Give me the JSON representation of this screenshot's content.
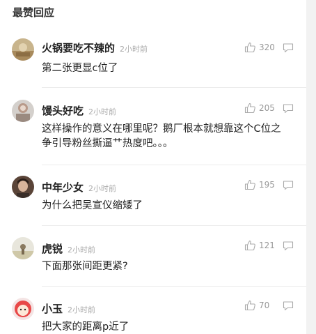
{
  "section": {
    "title": "最赞回应"
  },
  "comments": [
    {
      "user": "火锅要吃不辣的",
      "time": "2小时前",
      "likes": "320",
      "text": "第二张更显c位了"
    },
    {
      "user": "馒头好吃",
      "time": "2小时前",
      "likes": "205",
      "text": "这样操作的意义在哪里呢？鹅厂根本就想靠这个C位之争引导粉丝撕逼艹热度吧。。。"
    },
    {
      "user": "中年少女",
      "time": "2小时前",
      "likes": "195",
      "text": "为什么把吴宣仪缩矮了"
    },
    {
      "user": "虎锐",
      "time": "2小时前",
      "likes": "121",
      "text": "下面那张间距更紧?"
    },
    {
      "user": "小玉",
      "time": "2小时前",
      "likes": "70",
      "text": "把大家的距离p近了"
    }
  ]
}
